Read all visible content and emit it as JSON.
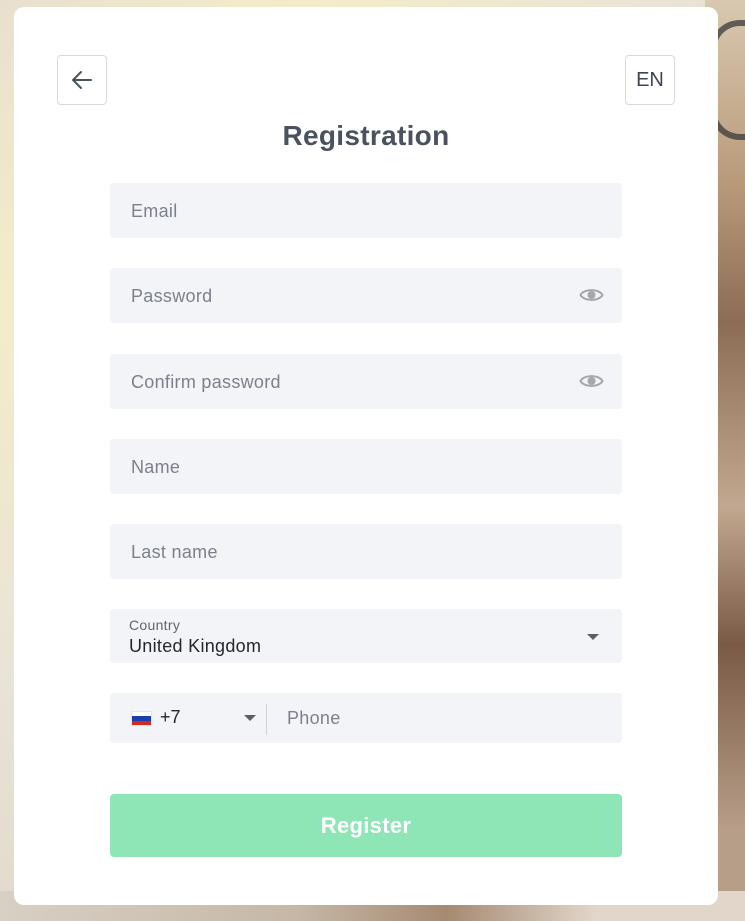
{
  "header": {
    "back_icon": "arrow-left-icon",
    "language": "EN",
    "title": "Registration"
  },
  "form": {
    "email": {
      "placeholder": "Email",
      "value": ""
    },
    "password": {
      "placeholder": "Password",
      "value": "",
      "icon": "eye-icon"
    },
    "confirm_password": {
      "placeholder": "Confirm password",
      "value": "",
      "icon": "eye-icon"
    },
    "first_name": {
      "placeholder": "Name",
      "value": ""
    },
    "last_name": {
      "placeholder": "Last name",
      "value": ""
    },
    "country": {
      "label": "Country",
      "value": "United Kingdom"
    },
    "phone": {
      "country_code": "+7",
      "flag": "russia-flag-icon",
      "placeholder": "Phone",
      "value": ""
    }
  },
  "actions": {
    "register_label": "Register"
  },
  "colors": {
    "register_button": "#8ee6b7",
    "field_background": "#f3f4f7",
    "title_text": "#4a5260"
  }
}
